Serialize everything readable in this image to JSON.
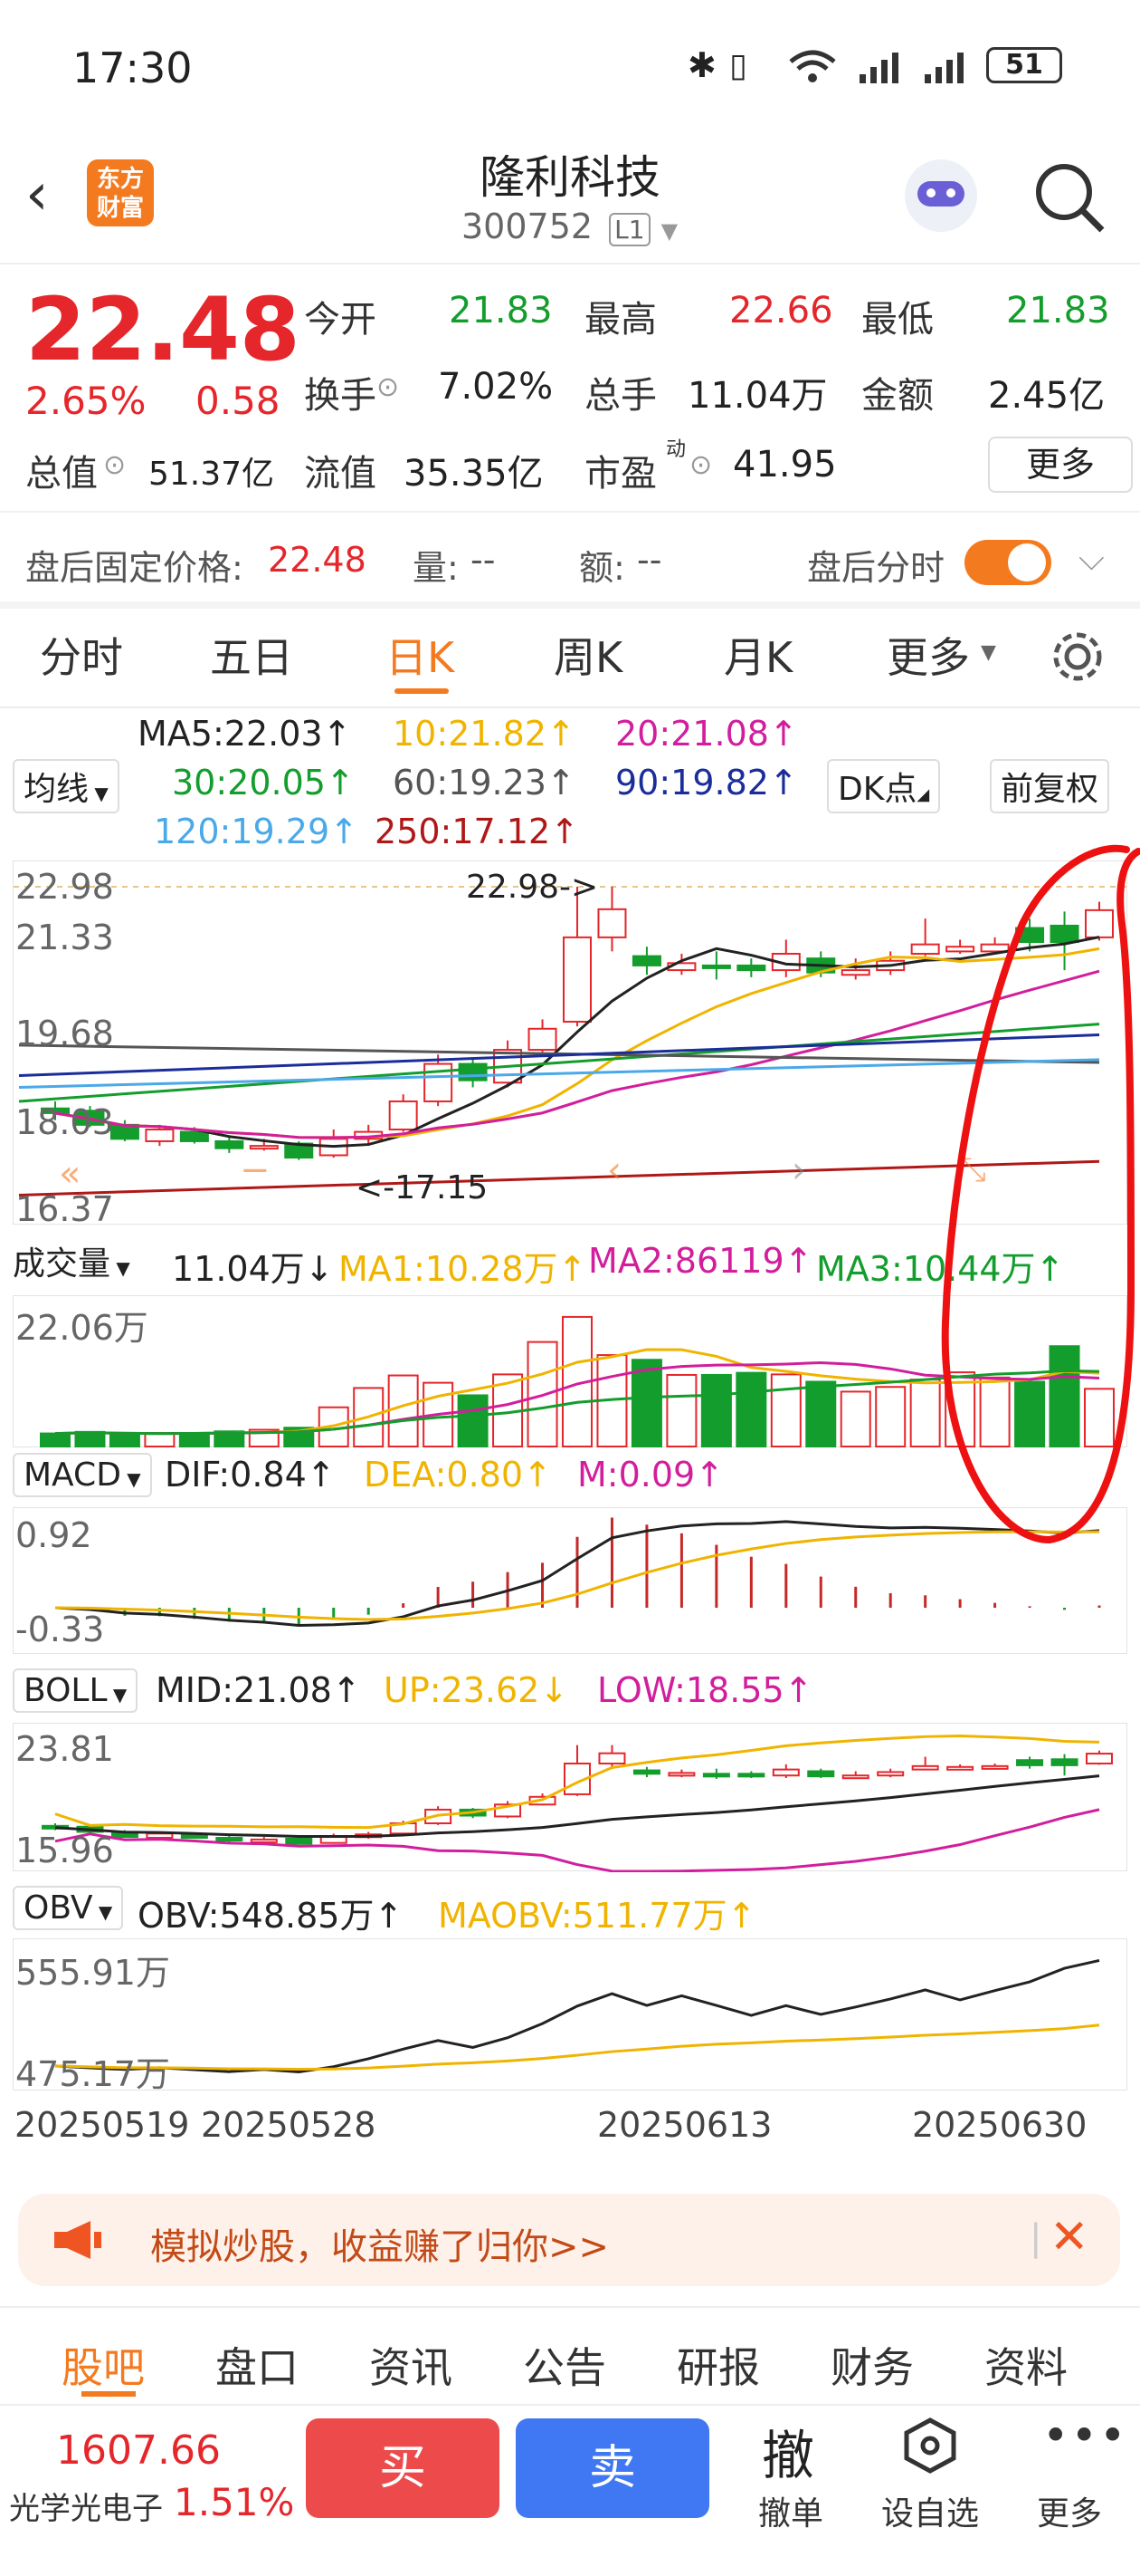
{
  "status": {
    "time": "17:30",
    "battery": "51"
  },
  "header": {
    "title": "隆利科技",
    "code": "300752",
    "level": "L1",
    "logo_text_1": "东方",
    "logo_text_2": "财富"
  },
  "quote": {
    "price": "22.48",
    "change_pct": "2.65%",
    "change": "0.58",
    "open_label": "今开",
    "open": "21.83",
    "high_label": "最高",
    "high": "22.66",
    "low_label": "最低",
    "low": "21.83",
    "turnover_label": "换手",
    "turnover": "7.02%",
    "volume_label": "总手",
    "volume": "11.04万",
    "amount_label": "金额",
    "amount": "2.45亿",
    "mktcap_label": "总值",
    "mktcap": "51.37亿",
    "float_label": "流值",
    "float": "35.35亿",
    "pe_label": "市盈",
    "pe_sup": "动",
    "pe": "41.95",
    "more": "更多"
  },
  "after_hours": {
    "label": "盘后固定价格:",
    "price": "22.48",
    "vol_label": "量:",
    "vol": "--",
    "amt_label": "额:",
    "amt": "--",
    "toggle_label": "盘后分时"
  },
  "tabs": [
    "分时",
    "五日",
    "日K",
    "周K",
    "月K",
    "更多"
  ],
  "ma_legend": {
    "selector": "均线",
    "ma5": "MA5:22.03↑",
    "ma10": "10:21.82↑",
    "ma20": "20:21.08↑",
    "ma30": "30:20.05↑",
    "ma60": "60:19.23↑",
    "ma90": "90:19.82↑",
    "ma120": "120:19.29↑",
    "ma250": "250:17.12↑",
    "dk": "DK点",
    "fq": "前复权"
  },
  "kline_axis": {
    "top": "22.98",
    "l2": "21.33",
    "l3": "19.68",
    "l4": "18.03",
    "bottom": "16.37",
    "high_mark": "22.98->",
    "low_mark": "<-17.15"
  },
  "volume": {
    "selector": "成交量",
    "value": "11.04万↓",
    "ma1": "MA1:10.28万↑",
    "ma2": "MA2:86119↑",
    "ma3": "MA3:10.44万↑",
    "axis": "22.06万"
  },
  "macd": {
    "selector": "MACD",
    "dif": "DIF:0.84↑",
    "dea": "DEA:0.80↑",
    "m": "M:0.09↑",
    "axis_top": "0.92",
    "axis_bottom": "-0.33"
  },
  "boll": {
    "selector": "BOLL",
    "mid": "MID:21.08↑",
    "up": "UP:23.62↓",
    "low": "LOW:18.55↑",
    "axis_top": "23.81",
    "axis_bottom": "15.96"
  },
  "obv": {
    "selector": "OBV",
    "obv": "OBV:548.85万↑",
    "maobv": "MAOBV:511.77万↑",
    "axis_top": "555.91万",
    "axis_bottom": "475.17万"
  },
  "dates": [
    "20250519",
    "20250528",
    "20250613",
    "20250630"
  ],
  "banner": {
    "text": "模拟炒股，收益赚了归你>>"
  },
  "bottom_tabs": [
    "股吧",
    "盘口",
    "资讯",
    "公告",
    "研报",
    "财务",
    "资料"
  ],
  "footer": {
    "index_value": "1607.66",
    "index_name": "光学光电子",
    "index_pct": "1.51%",
    "buy": "买",
    "sell": "卖",
    "cancel_icon": "撤",
    "cancel": "撤单",
    "watch": "设自选",
    "more": "更多"
  },
  "chart_data": {
    "type": "candlestick",
    "dates_shown": [
      "20250519",
      "20250528",
      "20250613",
      "20250630"
    ],
    "candles": [
      {
        "o": 18.25,
        "c": 18.15,
        "h": 18.4,
        "l": 18.0
      },
      {
        "o": 18.2,
        "c": 17.9,
        "h": 18.3,
        "l": 17.85
      },
      {
        "o": 17.9,
        "c": 17.6,
        "h": 18.0,
        "l": 17.55
      },
      {
        "o": 17.55,
        "c": 17.8,
        "h": 17.9,
        "l": 17.45
      },
      {
        "o": 17.75,
        "c": 17.55,
        "h": 17.85,
        "l": 17.5
      },
      {
        "o": 17.55,
        "c": 17.4,
        "h": 17.65,
        "l": 17.3
      },
      {
        "o": 17.4,
        "c": 17.45,
        "h": 17.6,
        "l": 17.35
      },
      {
        "o": 17.5,
        "c": 17.2,
        "h": 17.55,
        "l": 17.15
      },
      {
        "o": 17.25,
        "c": 17.6,
        "h": 17.8,
        "l": 17.2
      },
      {
        "o": 17.6,
        "c": 17.75,
        "h": 17.9,
        "l": 17.5
      },
      {
        "o": 17.8,
        "c": 18.4,
        "h": 18.55,
        "l": 17.75
      },
      {
        "o": 18.4,
        "c": 19.2,
        "h": 19.4,
        "l": 18.3
      },
      {
        "o": 19.2,
        "c": 18.85,
        "h": 19.3,
        "l": 18.7
      },
      {
        "o": 18.8,
        "c": 19.5,
        "h": 19.7,
        "l": 18.7
      },
      {
        "o": 19.5,
        "c": 19.95,
        "h": 20.15,
        "l": 19.45
      },
      {
        "o": 20.1,
        "c": 21.9,
        "h": 22.98,
        "l": 20.0
      },
      {
        "o": 21.9,
        "c": 22.5,
        "h": 22.98,
        "l": 21.6
      },
      {
        "o": 21.5,
        "c": 21.3,
        "h": 21.7,
        "l": 21.1
      },
      {
        "o": 21.2,
        "c": 21.35,
        "h": 21.55,
        "l": 21.1
      },
      {
        "o": 21.3,
        "c": 21.25,
        "h": 21.6,
        "l": 21.0
      },
      {
        "o": 21.3,
        "c": 21.2,
        "h": 21.45,
        "l": 21.05
      },
      {
        "o": 21.2,
        "c": 21.55,
        "h": 21.85,
        "l": 21.05
      },
      {
        "o": 21.45,
        "c": 21.15,
        "h": 21.6,
        "l": 21.05
      },
      {
        "o": 21.1,
        "c": 21.2,
        "h": 21.45,
        "l": 21.0
      },
      {
        "o": 21.2,
        "c": 21.4,
        "h": 21.6,
        "l": 21.1
      },
      {
        "o": 21.55,
        "c": 21.75,
        "h": 22.3,
        "l": 21.5
      },
      {
        "o": 21.6,
        "c": 21.7,
        "h": 21.85,
        "l": 21.55
      },
      {
        "o": 21.6,
        "c": 21.75,
        "h": 21.9,
        "l": 21.55
      },
      {
        "o": 22.1,
        "c": 21.8,
        "h": 22.3,
        "l": 21.6
      },
      {
        "o": 22.15,
        "c": 21.8,
        "h": 22.45,
        "l": 21.2
      },
      {
        "o": 21.9,
        "c": 22.48,
        "h": 22.66,
        "l": 21.83
      }
    ],
    "volume_wan": [
      2.5,
      2.8,
      2.3,
      2.4,
      2.6,
      2.9,
      3.2,
      3.6,
      7.5,
      11.2,
      13.6,
      12.2,
      9.8,
      13.8,
      20.0,
      24.8,
      17.5,
      16.6,
      13.7,
      13.7,
      14.1,
      13.8,
      12.4,
      10.5,
      11.4,
      12.8,
      14.2,
      13.2,
      12.4,
      19.2,
      11.04
    ],
    "obv_axis": [
      "555.91万",
      "475.17万"
    ]
  }
}
